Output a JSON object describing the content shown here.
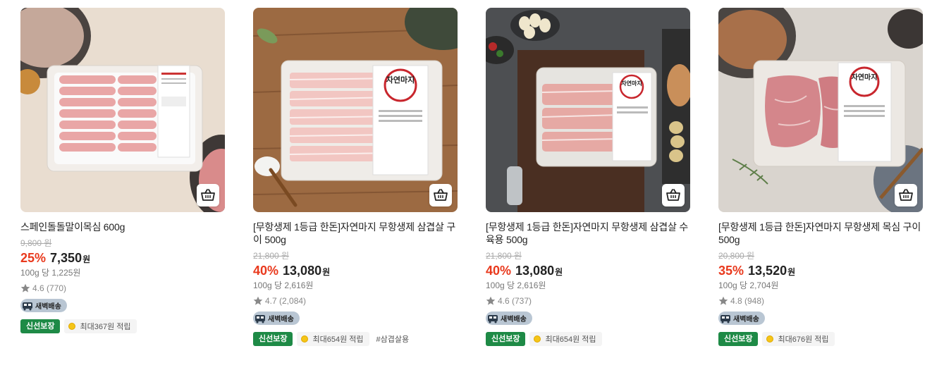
{
  "products": [
    {
      "title": "스페인돌돌말이목심 600g",
      "original_price": "9,800 원",
      "discount": "25%",
      "price": "7,350",
      "currency": "원",
      "unit_price": "100g 당 1,225원",
      "rating": "4.6 (770)",
      "delivery": "새벽배송",
      "fresh_badge": "신선보장",
      "points": "최대367원 적립",
      "tag": "",
      "package_label": "스페인 돌돌말이목심"
    },
    {
      "title": "[무항생제 1등급 한돈]자연마지 무항생제 삼겹살 구이 500g",
      "original_price": "21,800 원",
      "discount": "40%",
      "price": "13,080",
      "currency": "원",
      "unit_price": "100g 당 2,616원",
      "rating": "4.7 (2,084)",
      "delivery": "새벽배송",
      "fresh_badge": "신선보장",
      "points": "최대654원 적립",
      "tag": "#삼겹살용",
      "package_label": "자연마지"
    },
    {
      "title": "[무항생제 1등급 한돈]자연마지 무항생제 삼겹살 수육용 500g",
      "original_price": "21,800 원",
      "discount": "40%",
      "price": "13,080",
      "currency": "원",
      "unit_price": "100g 당 2,616원",
      "rating": "4.6 (737)",
      "delivery": "새벽배송",
      "fresh_badge": "신선보장",
      "points": "최대654원 적립",
      "tag": "",
      "package_label": "자연마지"
    },
    {
      "title": "[무항생제 1등급 한돈]자연마지 무항생제 목심 구이 500g",
      "original_price": "20,800 원",
      "discount": "35%",
      "price": "13,520",
      "currency": "원",
      "unit_price": "100g 당 2,704원",
      "rating": "4.8 (948)",
      "delivery": "새벽배송",
      "fresh_badge": "신선보장",
      "points": "최대676원 적립",
      "tag": "",
      "package_label": "자연마지"
    }
  ],
  "colors": {
    "discount": "#e9391d",
    "fresh_badge": "#1e8a46",
    "delivery_badge": "#b9c6d3"
  },
  "icons": [
    "cart-icon",
    "star-icon",
    "truck-icon",
    "coin-icon"
  ]
}
